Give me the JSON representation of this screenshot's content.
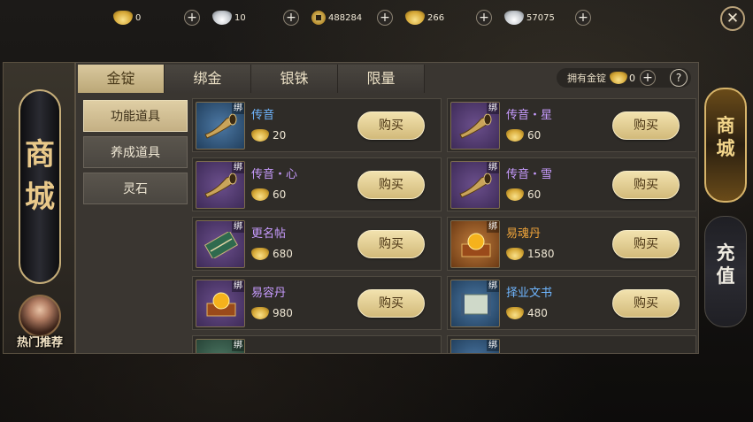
{
  "currencies": [
    {
      "icon": "gold-ingot-icon",
      "amount": "0"
    },
    {
      "icon": "silver-ingot-icon",
      "amount": "10"
    },
    {
      "icon": "copper-coin-icon",
      "amount": "488284"
    },
    {
      "icon": "gold-ingot-icon",
      "amount": "266"
    },
    {
      "icon": "silver-ingot-icon",
      "amount": "57075"
    }
  ],
  "add_symbol": "+",
  "close_symbol": "✕",
  "shop_title": "商城",
  "hot_recommend": "热门推荐",
  "tabs": [
    "金锭",
    "绑金",
    "银铢",
    "限量"
  ],
  "owned": {
    "label": "拥有金锭",
    "amount": "0",
    "help": "?"
  },
  "categories": [
    "功能道具",
    "养成道具",
    "灵石"
  ],
  "buy_label": "购买",
  "bind_tag": "绑",
  "items": [
    {
      "name": "传音",
      "price": "20",
      "name_color": "#6fb6ff",
      "thumb": "blue",
      "icon": "horn-icon"
    },
    {
      "name": "传音・星",
      "price": "60",
      "name_color": "#c89cff",
      "thumb": "purple",
      "icon": "horn-icon"
    },
    {
      "name": "传音・心",
      "price": "60",
      "name_color": "#c89cff",
      "thumb": "purple",
      "icon": "horn-icon"
    },
    {
      "name": "传音・雪",
      "price": "60",
      "name_color": "#c89cff",
      "thumb": "purple",
      "icon": "horn-icon"
    },
    {
      "name": "更名帖",
      "price": "680",
      "name_color": "#c89cff",
      "thumb": "purple",
      "icon": "scroll-card-icon"
    },
    {
      "name": "易魂丹",
      "price": "1580",
      "name_color": "#f0a53a",
      "thumb": "orange",
      "icon": "pill-box-icon"
    },
    {
      "name": "易容丹",
      "price": "980",
      "name_color": "#c89cff",
      "thumb": "purple",
      "icon": "pill-box-icon"
    },
    {
      "name": "择业文书",
      "price": "480",
      "name_color": "#6fb6ff",
      "thumb": "blue",
      "icon": "document-scroll-icon"
    }
  ],
  "side_tabs": [
    "商城",
    "充值"
  ],
  "colors": {
    "accent_gold": "#d9c89e",
    "panel": "#3a3631"
  }
}
